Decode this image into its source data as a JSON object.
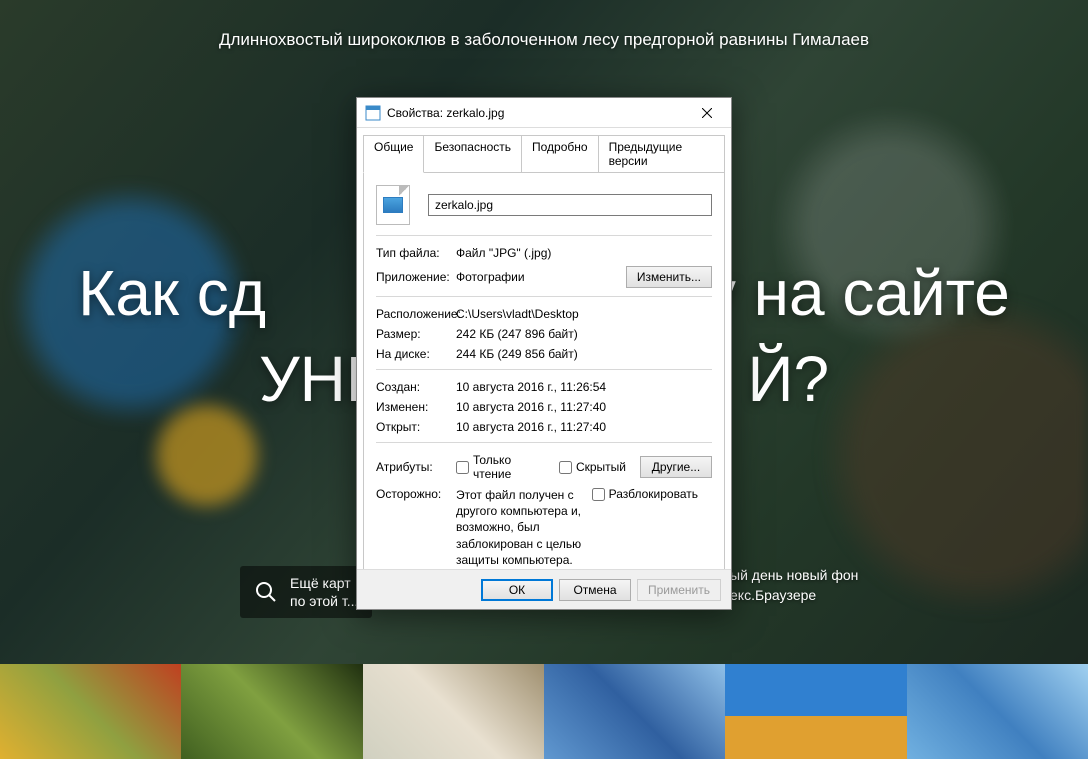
{
  "background": {
    "subtitle": "Длиннохвостый ширококлюв в заболоченном лесу предгорной равнины Гималаев",
    "title": "Как сд                       ку на сайте\nУНИ                    Й?",
    "search_line1": "Ещё карт",
    "search_line2": "по этой т...",
    "right_line1": "ый день новый фон",
    "right_line2": "екс.Браузере"
  },
  "dialog": {
    "title": "Свойства: zerkalo.jpg",
    "tabs": {
      "general": "Общие",
      "security": "Безопасность",
      "details": "Подробно",
      "prev": "Предыдущие версии"
    },
    "filename": "zerkalo.jpg",
    "labels": {
      "type": "Тип файла:",
      "app": "Приложение:",
      "change": "Изменить...",
      "location": "Расположение:",
      "size": "Размер:",
      "ondisk": "На диске:",
      "created": "Создан:",
      "modified": "Изменен:",
      "accessed": "Открыт:",
      "attrs": "Атрибуты:",
      "readonly": "Только чтение",
      "hidden": "Скрытый",
      "other": "Другие...",
      "careful": "Осторожно:",
      "warn": "Этот файл получен с другого компьютера и, возможно, был заблокирован с целью защиты компьютера.",
      "unblock": "Разблокировать"
    },
    "values": {
      "type": "Файл \"JPG\" (.jpg)",
      "app": "Фотографии",
      "location": "C:\\Users\\vladt\\Desktop",
      "size": "242 КБ (247 896 байт)",
      "ondisk": "244 КБ (249 856 байт)",
      "created": "10 августа 2016 г., 11:26:54",
      "modified": "10 августа 2016 г., 11:27:40",
      "accessed": "10 августа 2016 г., 11:27:40"
    },
    "buttons": {
      "ok": "ОК",
      "cancel": "Отмена",
      "apply": "Применить"
    }
  }
}
